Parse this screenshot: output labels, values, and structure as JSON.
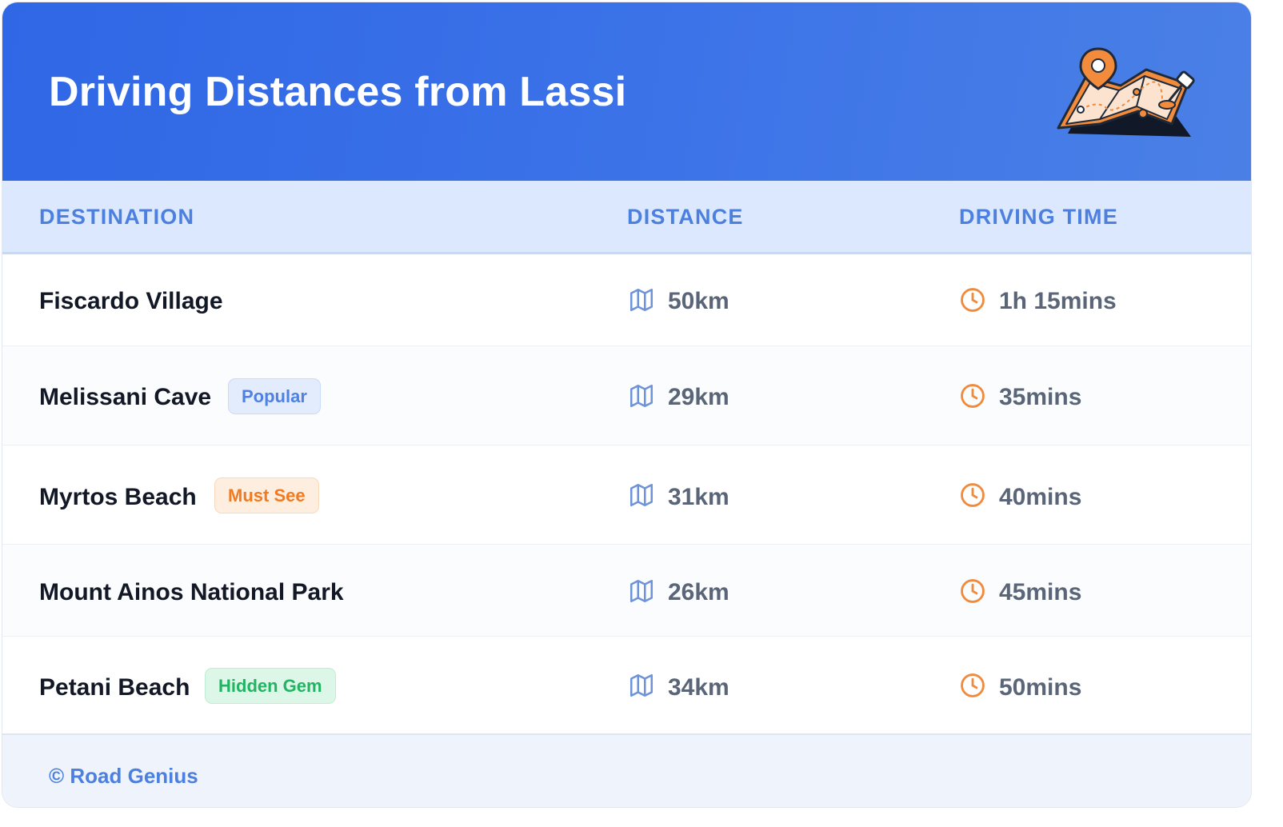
{
  "header": {
    "title": "Driving Distances from Lassi"
  },
  "table": {
    "columns": [
      "DESTINATION",
      "DISTANCE",
      "DRIVING TIME"
    ],
    "rows": [
      {
        "destination": "Fiscardo Village",
        "badge": "",
        "distance": "50km",
        "time": "1h 15mins"
      },
      {
        "destination": "Melissani Cave",
        "badge": "Popular",
        "distance": "29km",
        "time": "35mins"
      },
      {
        "destination": "Myrtos Beach",
        "badge": "Must See",
        "distance": "31km",
        "time": "40mins"
      },
      {
        "destination": "Mount Ainos National Park",
        "badge": "",
        "distance": "26km",
        "time": "45mins"
      },
      {
        "destination": "Petani Beach",
        "badge": "Hidden Gem",
        "distance": "34km",
        "time": "50mins"
      }
    ]
  },
  "icons": {
    "distance": "map-icon",
    "time": "clock-icon",
    "header": "map-pin-illustration"
  },
  "colors": {
    "accent": "#2f67e6",
    "distance_icon": "#6f93d8",
    "time_icon": "#f08a3c",
    "popular": "#4f81e3",
    "must_see": "#f17b20",
    "hidden_gem": "#22b363"
  },
  "footer": {
    "credit": "© Road Genius"
  }
}
